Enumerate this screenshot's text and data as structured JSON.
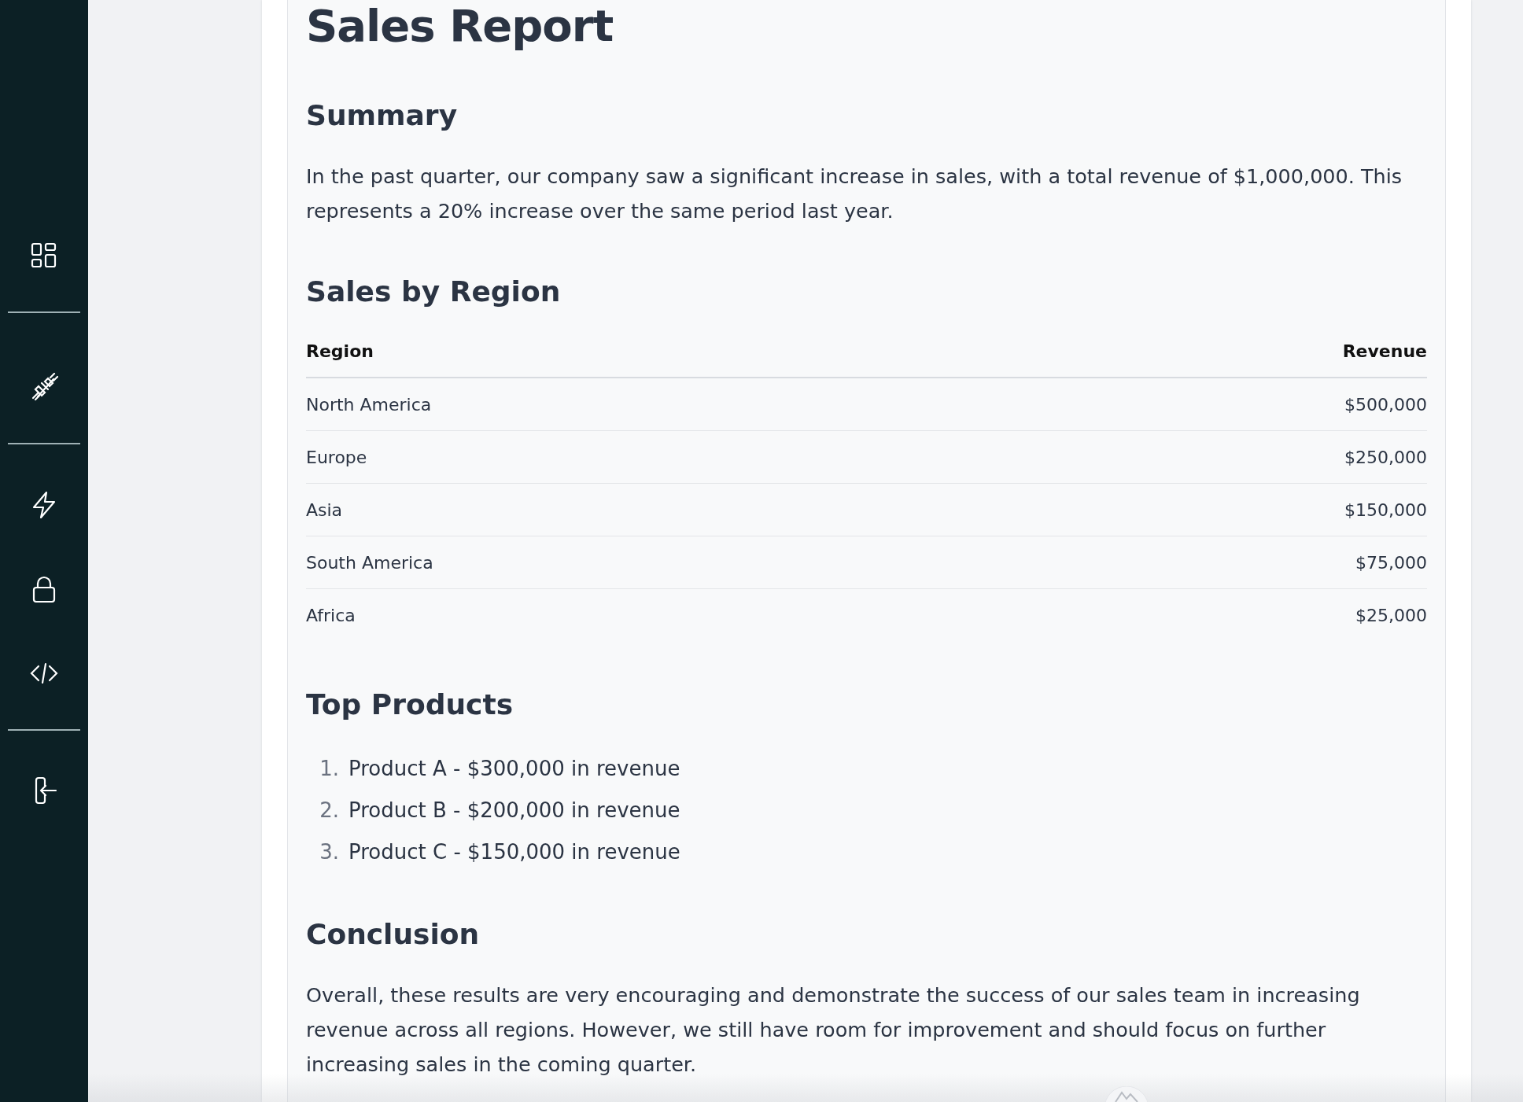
{
  "document": {
    "title": "Sales Report",
    "sections": [
      {
        "kind": "paragraph",
        "heading": "Summary",
        "text": "In the past quarter, our company saw a significant increase in sales, with a total revenue of $1,000,000. This represents a 20% increase over the same period last year."
      },
      {
        "kind": "table",
        "heading": "Sales by Region",
        "columns": [
          "Region",
          "Revenue"
        ],
        "rows": [
          [
            "North America",
            "$500,000"
          ],
          [
            "Europe",
            "$250,000"
          ],
          [
            "Asia",
            "$150,000"
          ],
          [
            "South America",
            "$75,000"
          ],
          [
            "Africa",
            "$25,000"
          ]
        ]
      },
      {
        "kind": "list",
        "heading": "Top Products",
        "items": [
          {
            "number": "1.",
            "text": "Product A - $300,000 in revenue"
          },
          {
            "number": "2.",
            "text": "Product B - $200,000 in revenue"
          },
          {
            "number": "3.",
            "text": "Product C - $150,000 in revenue"
          }
        ]
      },
      {
        "kind": "paragraph",
        "heading": "Conclusion",
        "text": "Overall, these results are very encouraging and demonstrate the success of our sales team in increasing revenue across all regions. However, we still have room for improvement and should focus on further increasing sales in the coming quarter."
      }
    ]
  }
}
